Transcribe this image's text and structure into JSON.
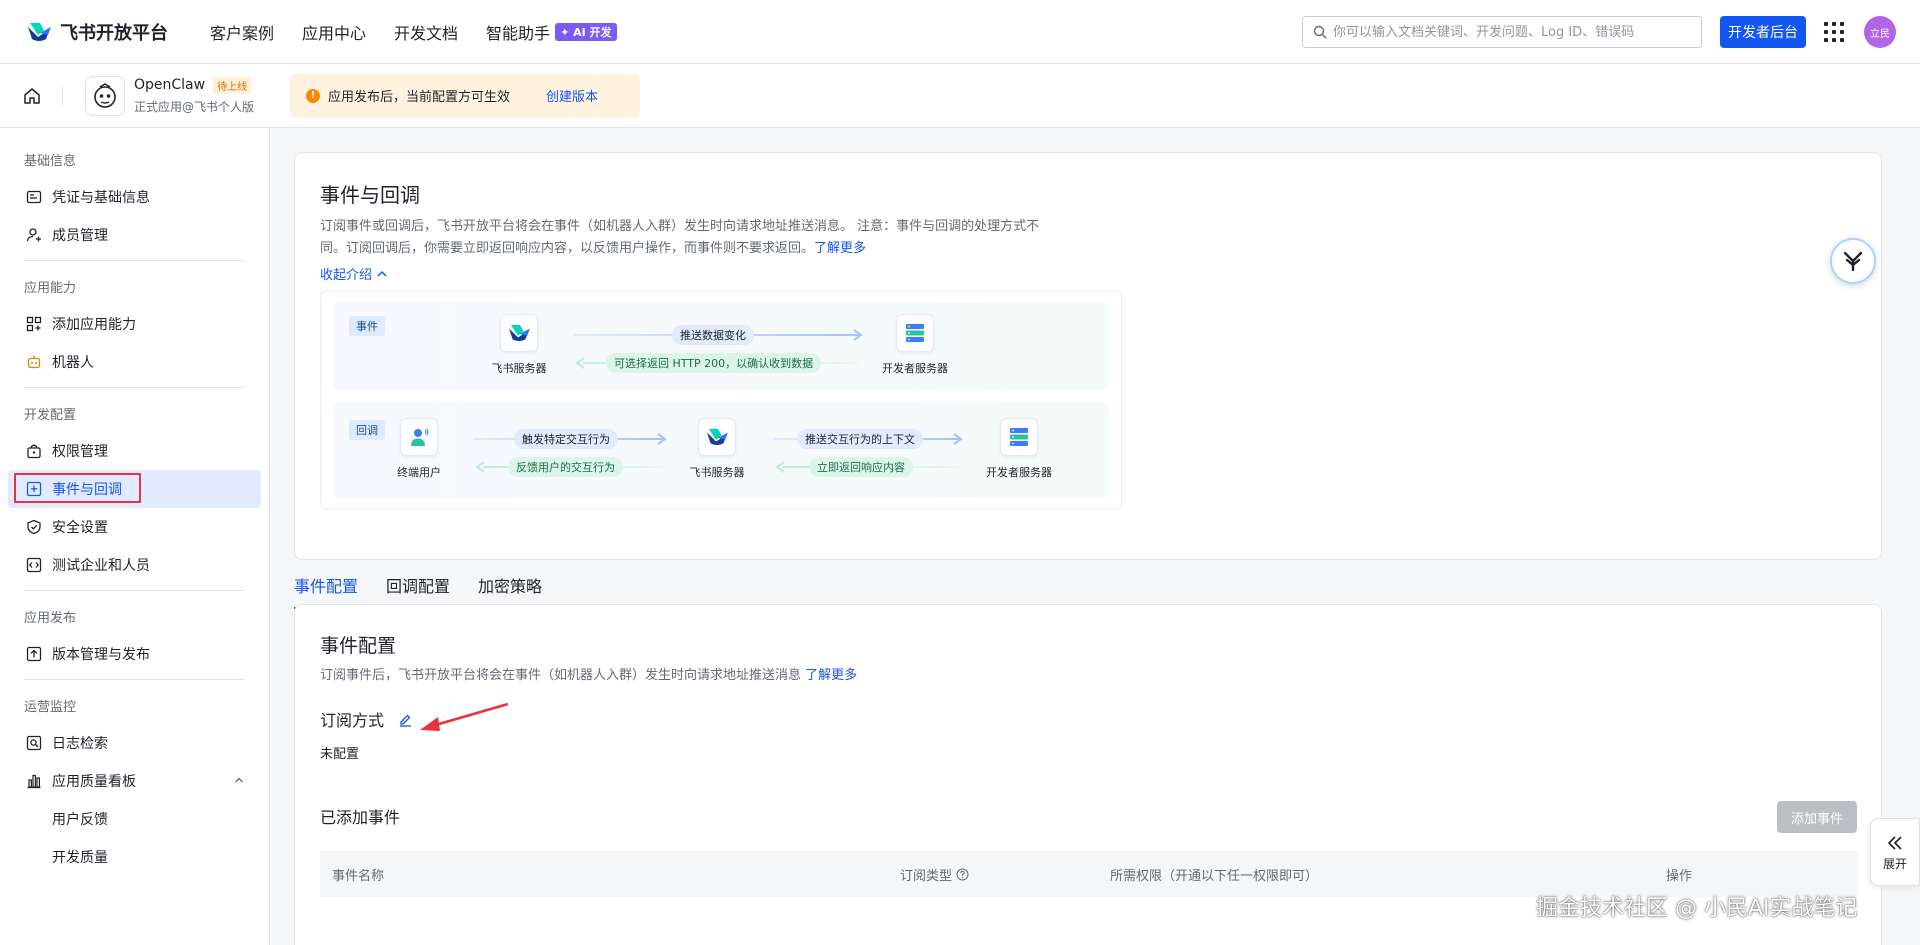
{
  "topnav": {
    "brand": "飞书开放平台",
    "links": [
      "客户案例",
      "应用中心",
      "开发文档",
      "智能助手"
    ],
    "ai_badge": "✦ AI 开发",
    "search_placeholder": "你可以输入文档关键词、开发问题、Log ID、错误码",
    "dev_button": "开发者后台",
    "avatar": "立民"
  },
  "app": {
    "name": "OpenClaw",
    "status": "待上线",
    "sub": "正式应用@飞书个人版",
    "notice": "应用发布后，当前配置方可生效",
    "notice_icon": "!",
    "notice_link": "创建版本"
  },
  "sidebar": {
    "groups": {
      "basic": "基础信息",
      "ability": "应用能力",
      "dev": "开发配置",
      "release": "应用发布",
      "ops": "运营监控"
    },
    "items": {
      "credentials": "凭证与基础信息",
      "members": "成员管理",
      "add_ability": "添加应用能力",
      "bot": "机器人",
      "permissions": "权限管理",
      "events": "事件与回调",
      "security": "安全设置",
      "test_org": "测试企业和人员",
      "version": "版本管理与发布",
      "logs": "日志检索",
      "quality": "应用质量看板",
      "feedback": "用户反馈",
      "dev_quality": "开发质量"
    }
  },
  "intro": {
    "title": "事件与回调",
    "desc1": "订阅事件或回调后，飞书开放平台将会在事件（如机器人入群）发生时向请求地址推送消息。 注意：事件与回调的处理方式不",
    "desc2": "同。订阅回调后，你需要立即返回响应内容，以反馈用户操作，而事件则不要求返回。",
    "learn_more": "了解更多",
    "collapse": "收起介绍",
    "diagram": {
      "event_tag": "事件",
      "callback_tag": "回调",
      "feishu_server": "飞书服务器",
      "dev_server": "开发者服务器",
      "end_user": "终端用户",
      "push_data": "推送数据变化",
      "optional_return": "可选择返回 HTTP 200，以确认收到数据",
      "trigger": "触发特定交互行为",
      "feedback": "反馈用户的交互行为",
      "push_context": "推送交互行为的上下文",
      "return_now": "立即返回响应内容"
    }
  },
  "tabs": [
    "事件配置",
    "回调配置",
    "加密策略"
  ],
  "config": {
    "title": "事件配置",
    "desc": "订阅事件后，飞书开放平台将会在事件（如机器人入群）发生时向请求地址推送消息",
    "learn_more": "了解更多",
    "sub_method": "订阅方式",
    "not_configured": "未配置",
    "added_events": "已添加事件",
    "add_button": "添加事件",
    "columns": [
      "事件名称",
      "订阅类型",
      "所需权限（开通以下任一权限即可）",
      "操作"
    ]
  },
  "expand_label": "展开",
  "watermark": "掘金技术社区 @ 小民AI实战笔记",
  "colors": {
    "accent": "#1456f0",
    "annotation": "#e8323c"
  }
}
